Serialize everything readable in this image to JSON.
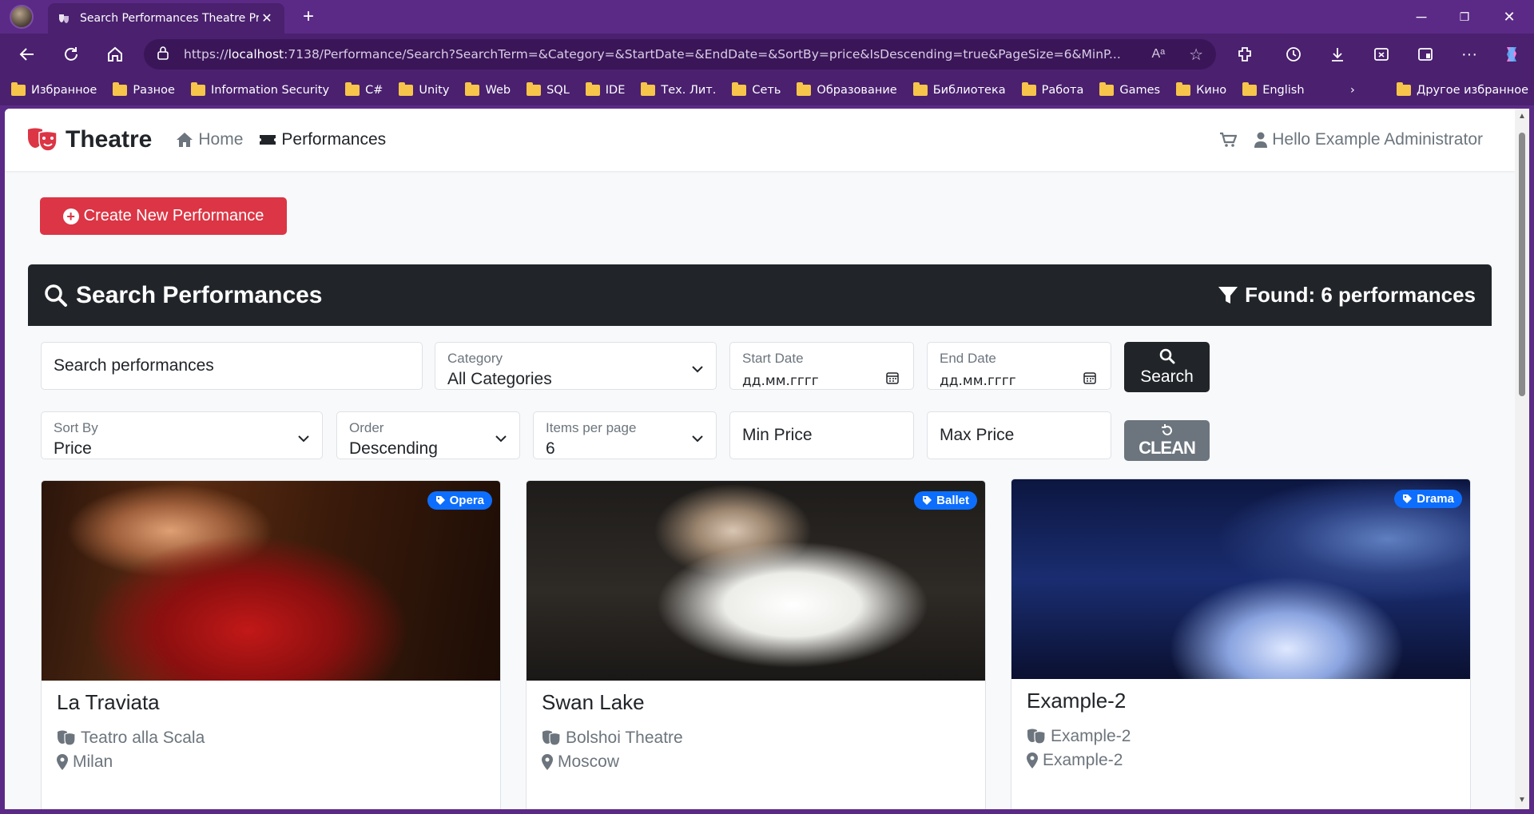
{
  "browser": {
    "tab_title": "Search Performances Theatre Proj",
    "url_prefix": "https://",
    "url_host": "localhost",
    "url_rest": ":7138/Performance/Search?SearchTerm=&Category=&StartDate=&EndDate=&SortBy=price&IsDescending=true&PageSize=6&MinP...",
    "bookmarks": [
      "Избранное",
      "Разное",
      "Information Security",
      "C#",
      "Unity",
      "Web",
      "SQL",
      "IDE",
      "Тех. Лит.",
      "Сеть",
      "Образование",
      "Библиотека",
      "Работа",
      "Games",
      "Кино",
      "English"
    ],
    "other_bookmarks": "Другое избранное"
  },
  "navbar": {
    "brand": "Theatre",
    "home": "Home",
    "performances": "Performances",
    "user_greeting": "Hello Example Administrator"
  },
  "create_button": "Create New Performance",
  "search_panel": {
    "title": "Search Performances",
    "found": "Found: 6 performances",
    "search_placeholder": "Search performances",
    "category_label": "Category",
    "category_value": "All Categories",
    "start_date_label": "Start Date",
    "start_date_value": "дд.мм.гггг",
    "end_date_label": "End Date",
    "end_date_value": "дд.мм.гггг",
    "search_button": "Search",
    "sort_label": "Sort By",
    "sort_value": "Price",
    "order_label": "Order",
    "order_value": "Descending",
    "per_page_label": "Items per page",
    "per_page_value": "6",
    "min_price_placeholder": "Min Price",
    "max_price_placeholder": "Max Price",
    "clean_button": "CLEAN"
  },
  "cards": [
    {
      "title": "La Traviata",
      "theatre": "Teatro alla Scala",
      "city": "Milan",
      "category": "Opera"
    },
    {
      "title": "Swan Lake",
      "theatre": "Bolshoi Theatre",
      "city": "Moscow",
      "category": "Ballet"
    },
    {
      "title": "Example-2",
      "theatre": "Example-2",
      "city": "Example-2",
      "category": "Drama"
    }
  ],
  "colors": {
    "accent_red": "#dc3545",
    "dark": "#212529",
    "badge_blue": "#0d6efd",
    "browser_purple": "#5b2a86"
  }
}
